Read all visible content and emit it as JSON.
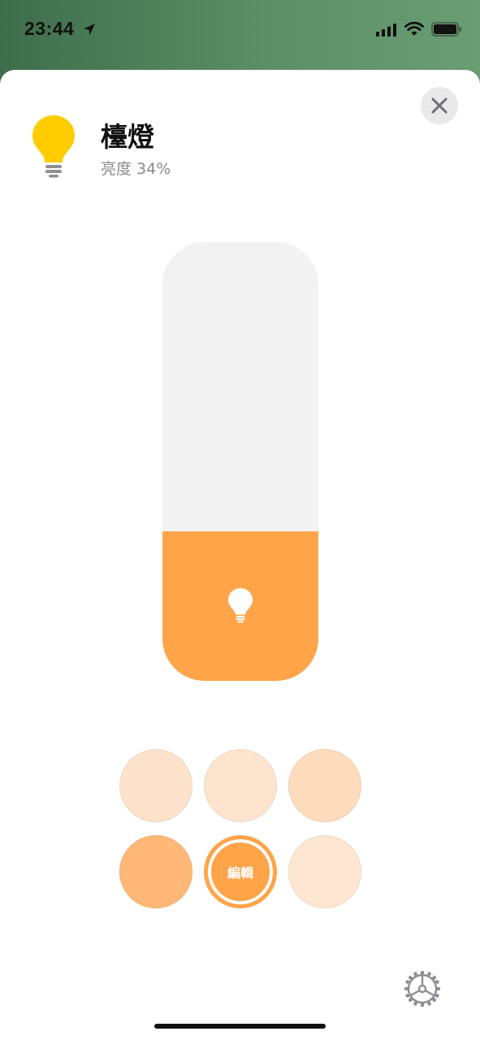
{
  "status_bar": {
    "time": "23:44",
    "icons": [
      "location-arrow-icon",
      "cellular-signal-icon",
      "wifi-icon",
      "battery-icon"
    ]
  },
  "accessory": {
    "name": "檯燈",
    "status": "亮度 34%",
    "brightness_percent": 34,
    "icon": "lightbulb-icon",
    "icon_color": "#ffcc00"
  },
  "controls": {
    "close_icon": "close-icon",
    "settings_icon": "gear-icon",
    "edit_label": "編輯"
  },
  "colors": {
    "accent": "#ffa449",
    "slider_track": "#f2f2f2"
  },
  "color_presets": [
    {
      "color": "#fde3cc"
    },
    {
      "color": "#fde4cf"
    },
    {
      "color": "#fddcbe"
    },
    {
      "color": "#ffb877"
    },
    {
      "color": "#ffa449",
      "selected": true
    },
    {
      "color": "#fde6d2"
    }
  ]
}
